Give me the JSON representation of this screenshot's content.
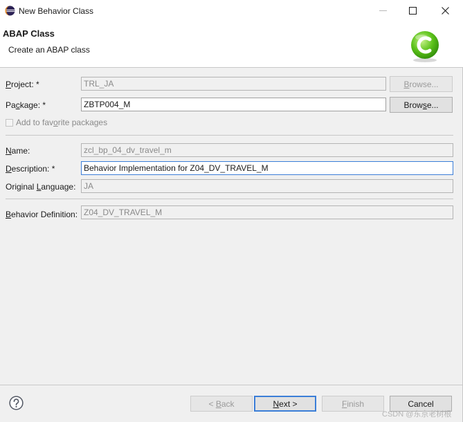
{
  "window": {
    "title": "New Behavior Class",
    "minimize_glyph": "—",
    "maximize_glyph": "☐",
    "close_glyph": "✕"
  },
  "banner": {
    "title": "ABAP Class",
    "description": "Create an ABAP class",
    "logo_icon": "abap-class-wizard-icon"
  },
  "form": {
    "project": {
      "label_prefix": "",
      "label_mnemonic": "P",
      "label_suffix": "roject: *",
      "value": "TRL_JA",
      "browse_prefix": "",
      "browse_mnemonic": "B",
      "browse_suffix": "rowse..."
    },
    "package": {
      "label_prefix": "Pa",
      "label_mnemonic": "c",
      "label_suffix": "kage: *",
      "value": "ZBTP004_M",
      "browse_prefix": "Brow",
      "browse_mnemonic": "s",
      "browse_suffix": "e..."
    },
    "favorite": {
      "label_prefix": "Add to fav",
      "label_mnemonic": "o",
      "label_suffix": "rite packages"
    },
    "name": {
      "label_prefix": "",
      "label_mnemonic": "N",
      "label_suffix": "ame:",
      "value": "zcl_bp_04_dv_travel_m"
    },
    "description": {
      "label_prefix": "",
      "label_mnemonic": "D",
      "label_suffix": "escription: *",
      "value": "Behavior Implementation for Z04_DV_TRAVEL_M"
    },
    "original_language": {
      "label_prefix": "Original ",
      "label_mnemonic": "L",
      "label_suffix": "anguage:",
      "value": "JA"
    },
    "behavior_definition": {
      "label_prefix": "",
      "label_mnemonic": "B",
      "label_suffix": "ehavior Definition:",
      "value": "Z04_DV_TRAVEL_M"
    }
  },
  "footer": {
    "help_icon": "help-question-icon",
    "back": {
      "prefix": "< ",
      "mnemonic": "B",
      "suffix": "ack"
    },
    "next": {
      "prefix": "",
      "mnemonic": "N",
      "suffix": "ext >"
    },
    "finish": {
      "prefix": "",
      "mnemonic": "F",
      "suffix": "inish"
    },
    "cancel": {
      "label": "Cancel"
    }
  },
  "watermark": "CSDN @东京老树根",
  "colors": {
    "focus_border": "#3b7ed8",
    "logo_green": "#5cc21a",
    "disabled_text": "#8a8a8a"
  }
}
